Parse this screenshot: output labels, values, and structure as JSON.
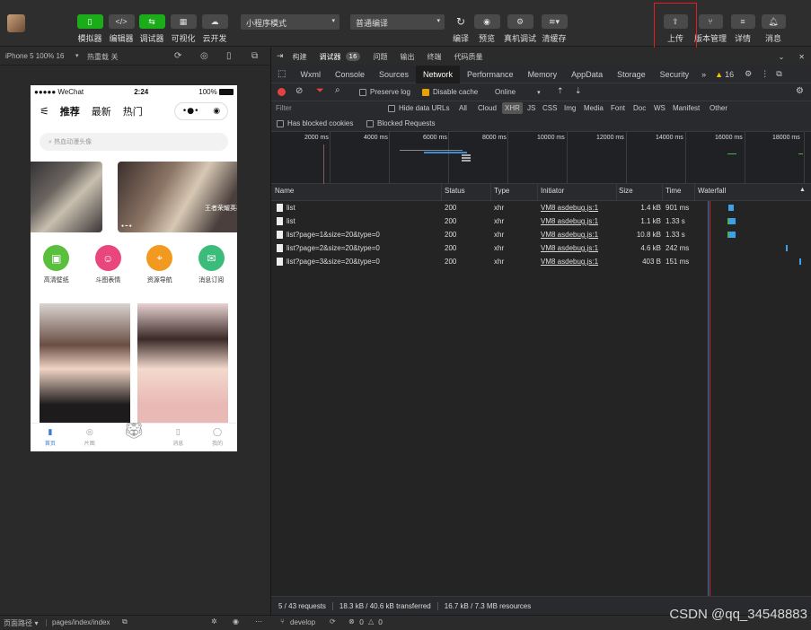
{
  "toolbar": {
    "left_buttons": [
      {
        "label": "模拟器",
        "icon": "phone-icon"
      },
      {
        "label": "编辑器",
        "icon": "code-icon"
      },
      {
        "label": "调试器",
        "icon": "debug-icon"
      },
      {
        "label": "可视化",
        "icon": "visual-icon"
      },
      {
        "label": "云开发",
        "icon": "cloud-icon"
      }
    ],
    "mode_select": "小程序模式",
    "compile_select": "普通编译",
    "mid_buttons": [
      {
        "label": "编译",
        "icon": "refresh-icon"
      },
      {
        "label": "预览",
        "icon": "eye-icon"
      },
      {
        "label": "真机调试",
        "icon": "gear-icon"
      },
      {
        "label": "清缓存",
        "icon": "layers-icon"
      }
    ],
    "right_buttons": [
      {
        "label": "上传",
        "icon": "upload-icon"
      },
      {
        "label": "版本管理",
        "icon": "branch-icon"
      },
      {
        "label": "详情",
        "icon": "menu-icon"
      },
      {
        "label": "消息",
        "icon": "bell-icon"
      }
    ]
  },
  "simulator": {
    "device": "iPhone 5 100% 16",
    "hot_reload": "热重载 关",
    "status_bar": {
      "carrier": "●●●●● WeChat",
      "time": "2:24",
      "battery": "100%"
    },
    "nav_tabs": [
      "推荐",
      "最新",
      "热门"
    ],
    "search_placeholder": "热血动漫头像",
    "banner_text": "王者荣耀英雄",
    "categories": [
      {
        "label": "高清壁纸",
        "color": "#5bbf3e"
      },
      {
        "label": "斗图表情",
        "color": "#e8467c"
      },
      {
        "label": "资源导航",
        "color": "#f29a1f"
      },
      {
        "label": "消息订阅",
        "color": "#3cbc7a"
      }
    ],
    "tabbar": [
      "首页",
      "片图",
      "",
      "消息",
      "我的"
    ]
  },
  "devtools": {
    "top_tabs": [
      "构建",
      "调试器",
      "16",
      "问题",
      "输出",
      "终端",
      "代码质量"
    ],
    "panel_tabs": [
      "Wxml",
      "Console",
      "Sources",
      "Network",
      "Performance",
      "Memory",
      "AppData",
      "Storage",
      "Security"
    ],
    "active_panel": "Network",
    "warn_count": "16",
    "preserve_log": "Preserve log",
    "disable_cache": "Disable cache",
    "throttle": "Online",
    "filter_placeholder": "Filter",
    "hide_data_urls": "Hide data URLs",
    "type_filters": [
      "All",
      "Cloud",
      "XHR",
      "JS",
      "CSS",
      "Img",
      "Media",
      "Font",
      "Doc",
      "WS",
      "Manifest",
      "Other"
    ],
    "active_filter": "XHR",
    "has_blocked_cookies": "Has blocked cookies",
    "blocked_requests": "Blocked Requests",
    "timeline_ticks": [
      "2000 ms",
      "4000 ms",
      "6000 ms",
      "8000 ms",
      "10000 ms",
      "12000 ms",
      "14000 ms",
      "16000 ms",
      "18000 ms"
    ],
    "columns": [
      "Name",
      "Status",
      "Type",
      "Initiator",
      "Size",
      "Time",
      "Waterfall"
    ],
    "rows": [
      {
        "name": "list",
        "status": "200",
        "type": "xhr",
        "initiator": "VM8 asdebug.js:1",
        "size": "1.4 kB",
        "time": "901 ms"
      },
      {
        "name": "list",
        "status": "200",
        "type": "xhr",
        "initiator": "VM8 asdebug.js:1",
        "size": "1.1 kB",
        "time": "1.33 s"
      },
      {
        "name": "list?page=1&size=20&type=0",
        "status": "200",
        "type": "xhr",
        "initiator": "VM8 asdebug.js:1",
        "size": "10.8 kB",
        "time": "1.33 s"
      },
      {
        "name": "list?page=2&size=20&type=0",
        "status": "200",
        "type": "xhr",
        "initiator": "VM8 asdebug.js:1",
        "size": "4.6 kB",
        "time": "242 ms"
      },
      {
        "name": "list?page=3&size=20&type=0",
        "status": "200",
        "type": "xhr",
        "initiator": "VM8 asdebug.js:1",
        "size": "403 B",
        "time": "151 ms"
      }
    ],
    "status_bar": {
      "requests": "5 / 43 requests",
      "transferred": "18.3 kB / 40.6 kB transferred",
      "resources": "16.7 kB / 7.3 MB resources"
    }
  },
  "bottom": {
    "page_path_label": "页面路径",
    "page_path": "pages/index/index",
    "branch": "develop",
    "errors": "0",
    "warnings": "0"
  },
  "watermark": "CSDN @qq_34548883"
}
